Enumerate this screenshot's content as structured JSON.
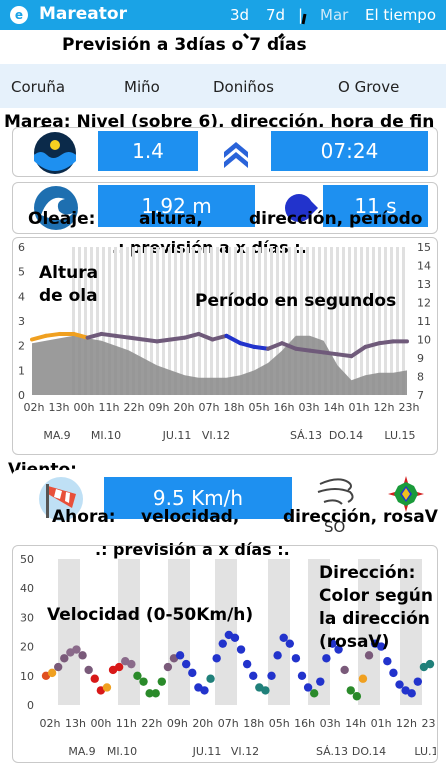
{
  "app": {
    "title": "Mareator",
    "btn_3d": "3d",
    "btn_7d": "7d",
    "separator": "|",
    "sea_tab": "Mar",
    "weather_tab": "El tiempo"
  },
  "annotations": {
    "forecast": "Previsión a 3días o 7 días",
    "tide": "Marea: Nivel (sobre 6), dirección, hora de fin",
    "waves": "Oleaje:",
    "wave_height": "altura,",
    "wave_dir": "dirección, período",
    "forecast_days": ".: previsión a x días :.",
    "wave_height_axis": "Altura\nde ola",
    "wave_period_axis": "Período en segundos",
    "wind": "Viento:",
    "wind_now": "Ahora:",
    "wind_speed": "velocidad,",
    "wind_dir": "dirección, rosaV",
    "wind_speed_axis": "Velocidad (0-50Km/h)",
    "wind_dir_color": "Dirección:\nColor según\nla dirección\n(rosaV)"
  },
  "tabs": [
    "Coruña",
    "Miño",
    "Doniños",
    "O Grove"
  ],
  "tide": {
    "level": "1.4",
    "end_time": "07:24",
    "direction": "up"
  },
  "waves": {
    "height": "1.92 m",
    "period": "11 s"
  },
  "wind": {
    "speed": "9.5 Km/h",
    "direction": "SO"
  },
  "colors": {
    "accent": "#1aa3e6",
    "box": "#1e90f0",
    "wave_band": "#6f5a7a",
    "orange": "#f0a020",
    "blue": "#2233cc"
  },
  "chart_data": [
    {
      "type": "line",
      "x_ticks": [
        "02h",
        "13h",
        "00h",
        "11h",
        "22h",
        "09h",
        "20h",
        "07h",
        "18h",
        "05h",
        "16h",
        "03h",
        "14h",
        "01h",
        "12h",
        "23h"
      ],
      "day_labels": [
        "MA.9",
        "MI.10",
        "JU.11",
        "VI.12",
        "SÁ.13",
        "DO.14",
        "LU.15"
      ],
      "y_left": [
        0,
        1,
        2,
        3,
        4,
        5,
        6
      ],
      "y_right": [
        7,
        8,
        9,
        10,
        11,
        12,
        13,
        14,
        15
      ],
      "series": [
        {
          "name": "Altura de ola",
          "axis": "left",
          "values": [
            2.1,
            2.2,
            2.3,
            2.4,
            2.3,
            2.2,
            2.0,
            1.8,
            1.5,
            1.2,
            1.0,
            0.8,
            0.7,
            0.7,
            0.7,
            0.8,
            1.0,
            1.3,
            1.8,
            2.4,
            2.4,
            2.2,
            1.2,
            0.6,
            0.8,
            0.9,
            0.9,
            1.0
          ]
        },
        {
          "name": "Período en segundos",
          "axis": "right",
          "values": [
            10.0,
            10.2,
            10.3,
            10.3,
            10.1,
            10.3,
            10.2,
            10.1,
            10.0,
            9.9,
            10.0,
            10.1,
            10.3,
            10.0,
            10.2,
            9.8,
            9.6,
            9.5,
            9.8,
            9.5,
            9.4,
            9.3,
            9.2,
            9.1,
            9.6,
            9.8,
            9.9,
            9.9
          ]
        }
      ]
    },
    {
      "type": "scatter",
      "x_ticks": [
        "02h",
        "13h",
        "00h",
        "11h",
        "22h",
        "09h",
        "20h",
        "07h",
        "18h",
        "05h",
        "16h",
        "03h",
        "14h",
        "01h",
        "12h",
        "23h"
      ],
      "day_labels": [
        "MA.9",
        "MI.10",
        "JU.11",
        "VI.12",
        "SÁ.13",
        "DO.14",
        "LU.15"
      ],
      "y_ticks": [
        0,
        10,
        20,
        30,
        40,
        50
      ],
      "ylim": [
        0,
        50
      ],
      "series": [
        {
          "name": "Velocidad (0-50Km/h)",
          "values": [
            10,
            11,
            13,
            16,
            18,
            19,
            17,
            12,
            9,
            5,
            6,
            12,
            13,
            15,
            14,
            10,
            8,
            4,
            4,
            8,
            13,
            16,
            17,
            14,
            11,
            6,
            5,
            9,
            16,
            21,
            24,
            23,
            19,
            14,
            10,
            6,
            5,
            10,
            17,
            23,
            21,
            16,
            10,
            6,
            4,
            8,
            16,
            21,
            19,
            12,
            5,
            3,
            9,
            17,
            21,
            20,
            15,
            11,
            7,
            5,
            4,
            8,
            13,
            14
          ]
        }
      ]
    }
  ]
}
